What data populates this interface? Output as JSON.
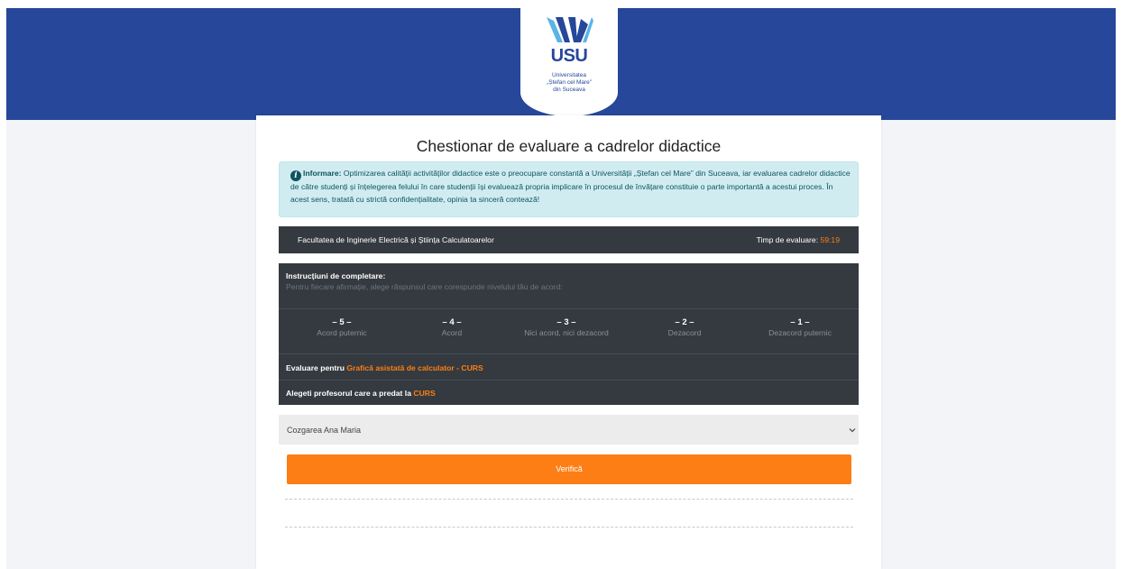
{
  "header": {
    "logo_abbr": "USU",
    "logo_line1": "Universitatea",
    "logo_line2": "„Ștefan cel Mare”",
    "logo_line3": "din Suceava"
  },
  "page_title": "Chestionar de evaluare a cadrelor didactice",
  "info": {
    "icon": "i",
    "label": "Informare:",
    "text": " Optimizarea calității activităților didactice este o preocupare constantă a Universității „Ștefan cel Mare” din Suceava, iar evaluarea cadrelor didactice de către studenți și înțelegerea felului în care studenții își evaluează propria implicare în procesul de învățare constituie o parte importantă a acestui proces. În acest sens, tratată cu strictă confidențialitate, opinia ta sinceră contează!"
  },
  "faculty_bar": {
    "faculty": "Facultatea de Inginerie Electrică și Știința Calculatoarelor",
    "timer_label": "Timp de evaluare: ",
    "timer_value": "59:19"
  },
  "instructions": {
    "heading": "Instrucțiuni de completare:",
    "text": "Pentru fiecare afirmație, alege răspunsul care corespunde nivelului tău de acord:",
    "scale": [
      {
        "num": "– 5 –",
        "label": "Acord puternic"
      },
      {
        "num": "– 4 –",
        "label": "Acord"
      },
      {
        "num": "– 3 –",
        "label": "Nici acord, nici dezacord"
      },
      {
        "num": "– 2 –",
        "label": "Dezacord"
      },
      {
        "num": "– 1 –",
        "label": "Dezacord puternic"
      }
    ],
    "eval_prefix": "Evaluare pentru ",
    "eval_course": "Grafică asistată de calculator - CURS",
    "prof_prefix": "Alegeti profesorul care a predat la ",
    "prof_type": "CURS"
  },
  "professor_select": {
    "selected": "Cozgarea Ana Maria"
  },
  "verify_button": "Verifică",
  "colors": {
    "brand_blue": "#26479a",
    "accent_orange": "#fd7e14",
    "dark_panel": "#343a40",
    "info_bg": "#d1ecf1"
  },
  "icons": [
    "university-logo-icon",
    "info-icon",
    "chevron-down-icon"
  ]
}
